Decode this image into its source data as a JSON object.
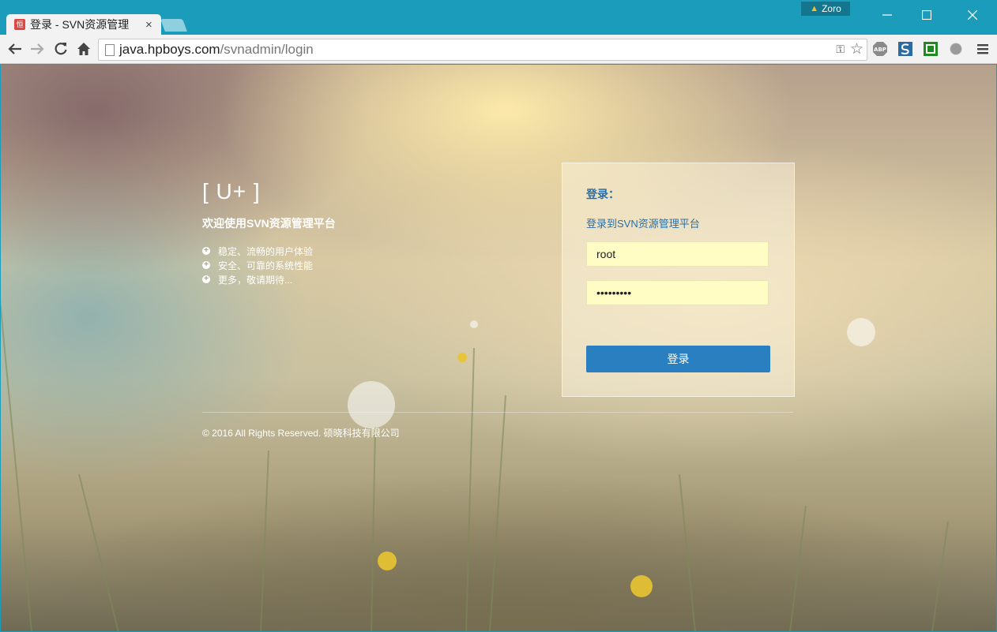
{
  "browser": {
    "tab": {
      "title": "登录 - SVN资源管理",
      "close_label": "×",
      "favicon_text": "恒"
    },
    "user_badge": "Zoro",
    "address": {
      "host": "java.hpboys.com",
      "path": "/svnadmin/login"
    },
    "nav_icons": [
      "back-icon",
      "forward-icon",
      "reload-icon",
      "home-icon"
    ],
    "extensions": [
      "adblock-icon",
      "s-extension-icon",
      "green-extension-icon",
      "swirl-extension-icon",
      "menu-icon"
    ]
  },
  "page": {
    "brand": "[ U+ ]",
    "welcome": "欢迎使用SVN资源管理平台",
    "features": [
      "稳定、流畅的用户体验",
      "安全、可靠的系统性能",
      "更多，敬请期待..."
    ],
    "login": {
      "heading": "登录：",
      "subheading": "登录到SVN资源管理平台",
      "username": "root",
      "password": "123456789",
      "button_label": "登录"
    },
    "footer": "© 2016 All Rights Reserved. 硕晓科技有限公司"
  },
  "colors": {
    "titlebar": "#1b9cba",
    "link_blue": "#2a6fa8",
    "button_blue": "#2a7fc0",
    "input_yellow": "#fffcc4"
  }
}
